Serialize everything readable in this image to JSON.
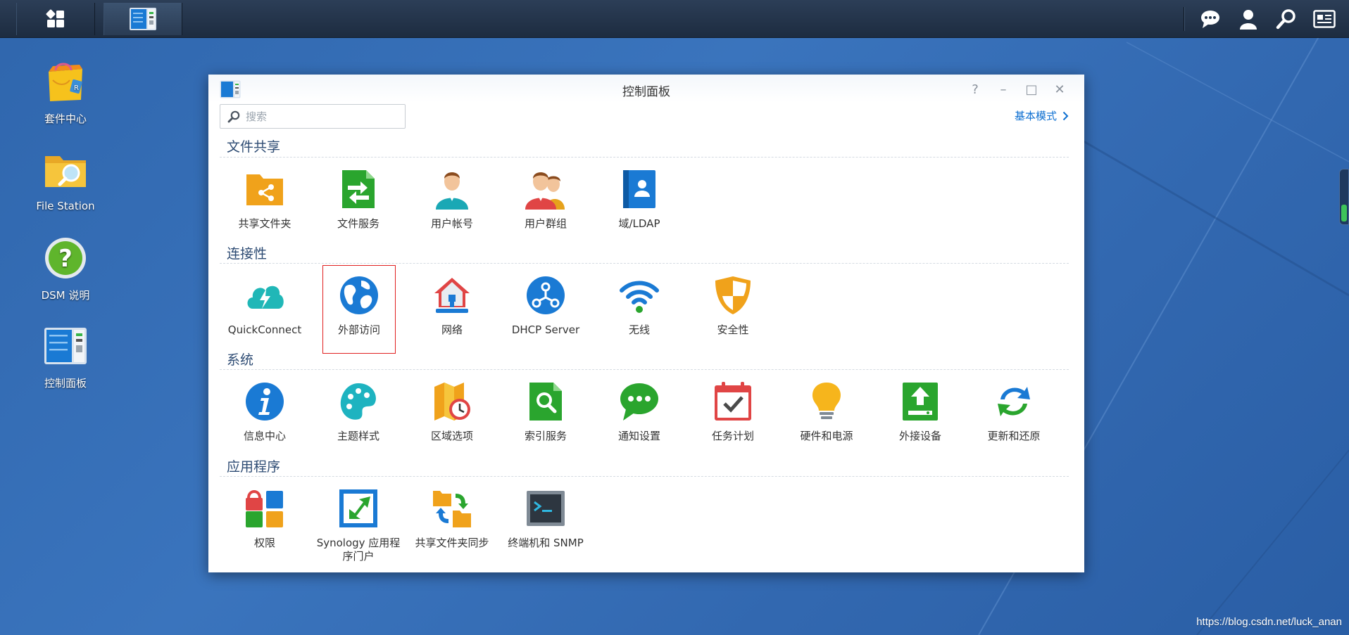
{
  "desktop": {
    "icons": [
      {
        "label": "套件中心"
      },
      {
        "label": "File Station"
      },
      {
        "label": "DSM 说明"
      },
      {
        "label": "控制面板"
      }
    ],
    "watermark": "https://blog.csdn.net/luck_anan"
  },
  "window": {
    "title": "控制面板",
    "controls": {
      "help": "?",
      "minimize": "–",
      "maximize": "□",
      "close": "✕"
    },
    "search": {
      "placeholder": "搜索",
      "value": ""
    },
    "basic_mode": "基本模式",
    "sections": [
      {
        "title": "文件共享",
        "items": [
          {
            "label": "共享文件夹"
          },
          {
            "label": "文件服务"
          },
          {
            "label": "用户帐号"
          },
          {
            "label": "用户群组"
          },
          {
            "label": "域/LDAP"
          }
        ]
      },
      {
        "title": "连接性",
        "items": [
          {
            "label": "QuickConnect"
          },
          {
            "label": "外部访问"
          },
          {
            "label": "网络"
          },
          {
            "label": "DHCP Server"
          },
          {
            "label": "无线"
          },
          {
            "label": "安全性"
          }
        ]
      },
      {
        "title": "系统",
        "items": [
          {
            "label": "信息中心"
          },
          {
            "label": "主题样式"
          },
          {
            "label": "区域选项"
          },
          {
            "label": "索引服务"
          },
          {
            "label": "通知设置"
          },
          {
            "label": "任务计划"
          },
          {
            "label": "硬件和电源"
          },
          {
            "label": "外接设备"
          },
          {
            "label": "更新和还原"
          }
        ]
      },
      {
        "title": "应用程序",
        "items": [
          {
            "label": "权限"
          },
          {
            "label": "Synology 应用程序门户"
          },
          {
            "label": "共享文件夹同步"
          },
          {
            "label": "终端机和 SNMP"
          }
        ]
      }
    ]
  }
}
